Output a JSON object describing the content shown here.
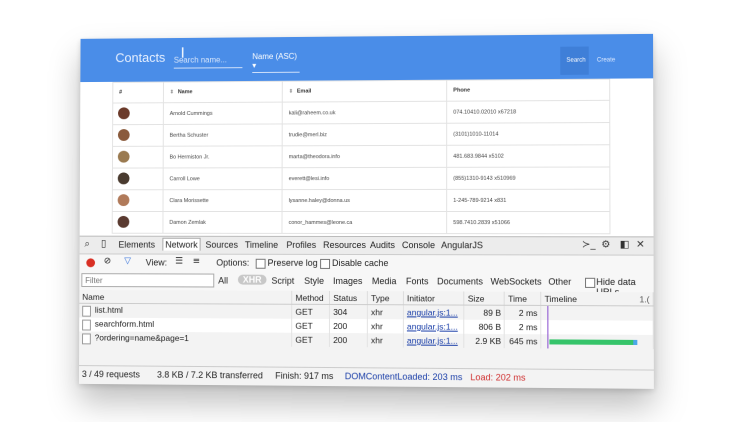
{
  "app": {
    "title": "Contacts",
    "search_placeholder": "Search name...",
    "sort_label": "Name (ASC)",
    "search_button": "Search",
    "create_button": "Create",
    "accent_color": "#4a8de8"
  },
  "contacts_table": {
    "headers": {
      "num": "#",
      "name": "Name",
      "email": "Email",
      "phone": "Phone"
    },
    "rows": [
      {
        "name": "Arnold Cummings",
        "email": "kali@raheem.co.uk",
        "phone": "074.10410.02010 x67218"
      },
      {
        "name": "Bertha Schuster",
        "email": "trudie@merl.biz",
        "phone": "(3101)1010-11014"
      },
      {
        "name": "Bo Hermiston Jr.",
        "email": "marta@theodora.info",
        "phone": "481.683.9844 x5102"
      },
      {
        "name": "Carroll Lowe",
        "email": "everett@lesi.info",
        "phone": "(855)1310-9143 x510969"
      },
      {
        "name": "Clara Morissette",
        "email": "lysanne.haley@donna.us",
        "phone": "1-245-789-9214 x831"
      },
      {
        "name": "Damon Zemlak",
        "email": "conor_hammes@leone.ca",
        "phone": "598.7410.2839 x51066"
      }
    ]
  },
  "devtools": {
    "tabs": [
      "Elements",
      "Network",
      "Sources",
      "Timeline",
      "Profiles",
      "Resources",
      "Audits",
      "Console",
      "AngularJS"
    ],
    "active_tab": "Network",
    "view_label": "View:",
    "options_label": "Options:",
    "preserve_log": "Preserve log",
    "disable_cache": "Disable cache",
    "filter_placeholder": "Filter",
    "filter_types": [
      "All",
      "XHR",
      "Script",
      "Style",
      "Images",
      "Media",
      "Fonts",
      "Documents",
      "WebSockets",
      "Other"
    ],
    "active_filter": "XHR",
    "hide_data_urls": "Hide data URLs",
    "columns": {
      "name": "Name",
      "method": "Method",
      "status": "Status",
      "type": "Type",
      "initiator": "Initiator",
      "size": "Size",
      "time": "Time",
      "timeline": "Timeline"
    },
    "timeline_tick": "1.(",
    "requests": [
      {
        "name": "list.html",
        "method": "GET",
        "status": "304",
        "type": "xhr",
        "initiator": "angular.js:1...",
        "size": "89 B",
        "time": "2 ms"
      },
      {
        "name": "searchform.html",
        "method": "GET",
        "status": "200",
        "type": "xhr",
        "initiator": "angular.js:1...",
        "size": "806 B",
        "time": "2 ms"
      },
      {
        "name": "?ordering=name&page=1",
        "method": "GET",
        "status": "200",
        "type": "xhr",
        "initiator": "angular.js:1...",
        "size": "2.9 KB",
        "time": "645 ms"
      }
    ],
    "status_bar": {
      "requests": "3 / 49 requests",
      "transferred": "3.8 KB / 7.2 KB transferred",
      "finish": "Finish: 917 ms",
      "dcl": "DOMContentLoaded: 203 ms",
      "load": "Load: 202 ms"
    }
  }
}
